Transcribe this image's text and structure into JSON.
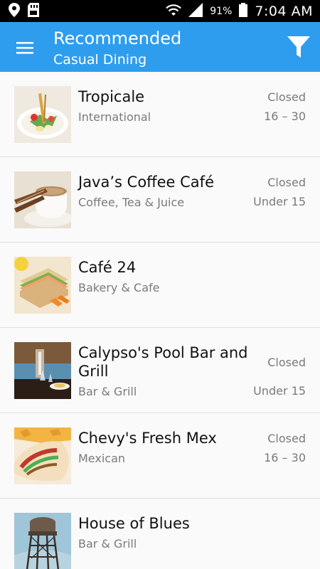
{
  "status_bar": {
    "battery": "91%",
    "time": "7:04 AM",
    "icons": [
      "location-icon",
      "sd-card-icon",
      "wifi-icon",
      "signal-icon",
      "battery-icon"
    ]
  },
  "app_bar": {
    "title": "Recommended",
    "subtitle": "Casual Dining",
    "color": "#2f9ded",
    "menu_icon": "hamburger-menu-icon",
    "filter_icon": "filter-funnel-icon"
  },
  "restaurants": [
    {
      "name": "Tropicale",
      "category": "International",
      "status": "Closed",
      "price": "16 – 30",
      "image": "salad-plate"
    },
    {
      "name": "Java’s Coffee Café",
      "category": "Coffee, Tea & Juice",
      "status": "Closed",
      "price": "Under 15",
      "image": "coffee-cup"
    },
    {
      "name": "Café 24",
      "category": "Bakery & Cafe",
      "status": "",
      "price": "",
      "image": "sandwich"
    },
    {
      "name": "Calypso's Pool Bar and Grill",
      "category": "Bar & Grill",
      "status": "Closed",
      "price": "Under 15",
      "image": "poolside-table"
    },
    {
      "name": "Chevy's Fresh Mex",
      "category": "Mexican",
      "status": "Closed",
      "price": "16 – 30",
      "image": "burrito-wrap"
    },
    {
      "name": "House of Blues",
      "category": "Bar & Grill",
      "status": "",
      "price": "",
      "image": "water-tower"
    }
  ]
}
